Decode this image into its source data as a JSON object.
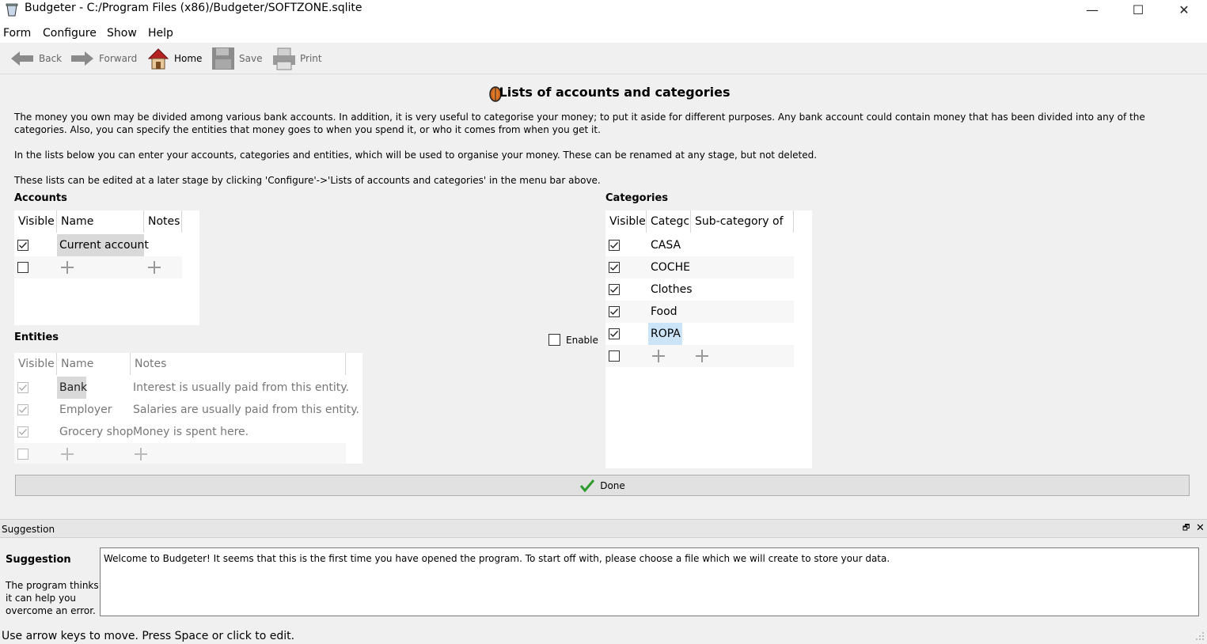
{
  "window": {
    "title": "Budgeter - C:/Program Files (x86)/Budgeter/SOFTZONE.sqlite",
    "minimize": "—",
    "maximize": "☐",
    "close": "✕"
  },
  "menu": [
    "Form",
    "Configure",
    "Show",
    "Help"
  ],
  "toolbar": {
    "back": "Back",
    "forward": "Forward",
    "home": "Home",
    "save": "Save",
    "print": "Print"
  },
  "page": {
    "heading": "Lists of accounts and categories",
    "para1": "The money you own may be divided among various bank accounts. In addition, it is very useful to categorise your money; to put it aside for different purposes. Any bank account could contain money that has been divided into any of the categories. Also, you can specify the entities that money goes to when you spend it, or who it comes from when you get it.",
    "para2": "In the lists below you can enter your accounts, categories and entities, which will be used to organise your money. These can be renamed at any stage, but not deleted.",
    "para3": "These lists can be edited at a later stage by clicking 'Configure'->'Lists of accounts and categories' in the menu bar above."
  },
  "accounts": {
    "label": "Accounts",
    "columns": [
      "Visible",
      "Name",
      "Notes"
    ],
    "rows": [
      {
        "visible": true,
        "name": "Current account",
        "notes": ""
      }
    ]
  },
  "entities": {
    "label": "Entities",
    "columns": [
      "Visible",
      "Name",
      "Notes"
    ],
    "rows": [
      {
        "visible": true,
        "name": "Bank",
        "notes": "Interest is usually paid from this entity."
      },
      {
        "visible": true,
        "name": "Employer",
        "notes": "Salaries are usually paid from this entity."
      },
      {
        "visible": true,
        "name": "Grocery shop",
        "notes": "Money is spent here."
      }
    ]
  },
  "enable": {
    "label": "Enable",
    "checked": false
  },
  "categories": {
    "label": "Categories",
    "columns": [
      "Visible",
      "Categc",
      "Sub-category of"
    ],
    "rows": [
      {
        "visible": true,
        "name": "CASA"
      },
      {
        "visible": true,
        "name": "COCHE"
      },
      {
        "visible": true,
        "name": "Clothes"
      },
      {
        "visible": true,
        "name": "Food"
      },
      {
        "visible": true,
        "name": "ROPA"
      }
    ]
  },
  "done": "Done",
  "suggestion": {
    "dock_title": "Suggestion",
    "heading": "Suggestion",
    "description": "The program thinks it can help you overcome an error.",
    "message": "Welcome to Budgeter! It seems that this is the first time you have opened the program. To start off with, please choose a file which we will create to store your data.",
    "float": "🗗",
    "close": "✕"
  },
  "status": "Use arrow keys to move. Press Space or click to edit.",
  "colors": {
    "check_accent": "#2e9b2e",
    "selection": "#cce4f7",
    "name_highlight": "#d9d9d9"
  }
}
